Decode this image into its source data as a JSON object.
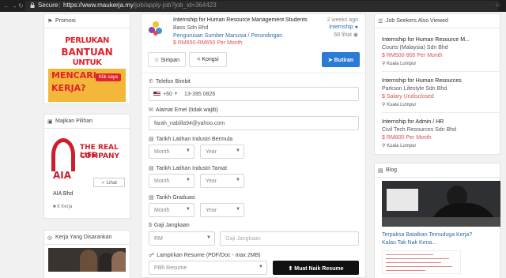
{
  "browser": {
    "secure_label": "Secure",
    "url_host": "https://www.maukerja.my",
    "url_path": "/job/apply-job?job_id=364423"
  },
  "left": {
    "promo": {
      "heading": "Promosi",
      "line1": "PERLUKAN",
      "line2": "BANTUAN",
      "line3": "UNTUK",
      "line4a": "MENCARI",
      "line4b": "KERJA?",
      "cta": "Klik saya"
    },
    "employer": {
      "heading": "Majikan Pilihan",
      "brand_line1": "THE REAL LIFE",
      "brand_line2": "COMPANY",
      "logo_text": "AIA",
      "name": "AIA Bhd",
      "jobs": "8 Kerja",
      "view_label": "Lihat"
    },
    "suggested": {
      "heading": "Kerja Yang Disarankan"
    }
  },
  "job": {
    "title": "Internship for Human Resource Management Students",
    "company": "Bass Sdn Bhd",
    "department": "Pengurusan Sumber Manusia / Perundingan",
    "salary": "RM650-RM650 Per Month",
    "posted": "2 weeks ago",
    "type": "Internship",
    "views": "68 lihat"
  },
  "actions": {
    "save": "Simpan",
    "share": "Kongsi",
    "continue": "Butiran"
  },
  "form": {
    "phone_label": "Telefon Bimbit",
    "phone_code": "+60",
    "phone_value": "13-395 0826",
    "email_label": "Alamat Emel (tidak wajib)",
    "email_value": "farah_nabilla94@yahoo.com",
    "start_label": "Tarikh Latihan Industri Bermula",
    "end_label": "Tarikh Latihan Industri Tamat",
    "grad_label": "Tarikh Graduasi",
    "month_placeholder": "Month",
    "year_placeholder": "Year",
    "salary_label": "Gaji Jangkaan",
    "currency": "RM",
    "salary_placeholder": "Gaji Jangkaan",
    "resume_label": "Lampirkan Resume (PDF/Doc - max 2MB)",
    "resume_select": "Pilih Resume",
    "upload_button": "Muat Naik Resume"
  },
  "right": {
    "viewed": {
      "heading": "Job Seekers Also Viewed",
      "jobs": [
        {
          "title": "Internship for Human Resource M...",
          "company": "Courts (Malaysia) Sdn Bhd",
          "salary": "RM500-800 Per Month",
          "location": "Kuala Lumpur"
        },
        {
          "title": "Internship for Human Resources",
          "company": "Parkson Lifestyle Sdn Bhd",
          "salary": "Salary Undisclosed",
          "location": "Kuala Lumpur"
        },
        {
          "title": "Internship for Admin / HR",
          "company": "Civil Tech Resources Sdn Bhd",
          "salary": "RM800 Per Month",
          "location": "Kuala Lumpur"
        }
      ]
    },
    "blog": {
      "heading": "Blog",
      "post_title": "Terpaksa Batalkan Temuduga Kerja? Kalau Tak Nak Kena..."
    }
  },
  "colors": {
    "accent": "#2a7bd3",
    "salary": "#d9534f",
    "link": "#2a6db0"
  }
}
